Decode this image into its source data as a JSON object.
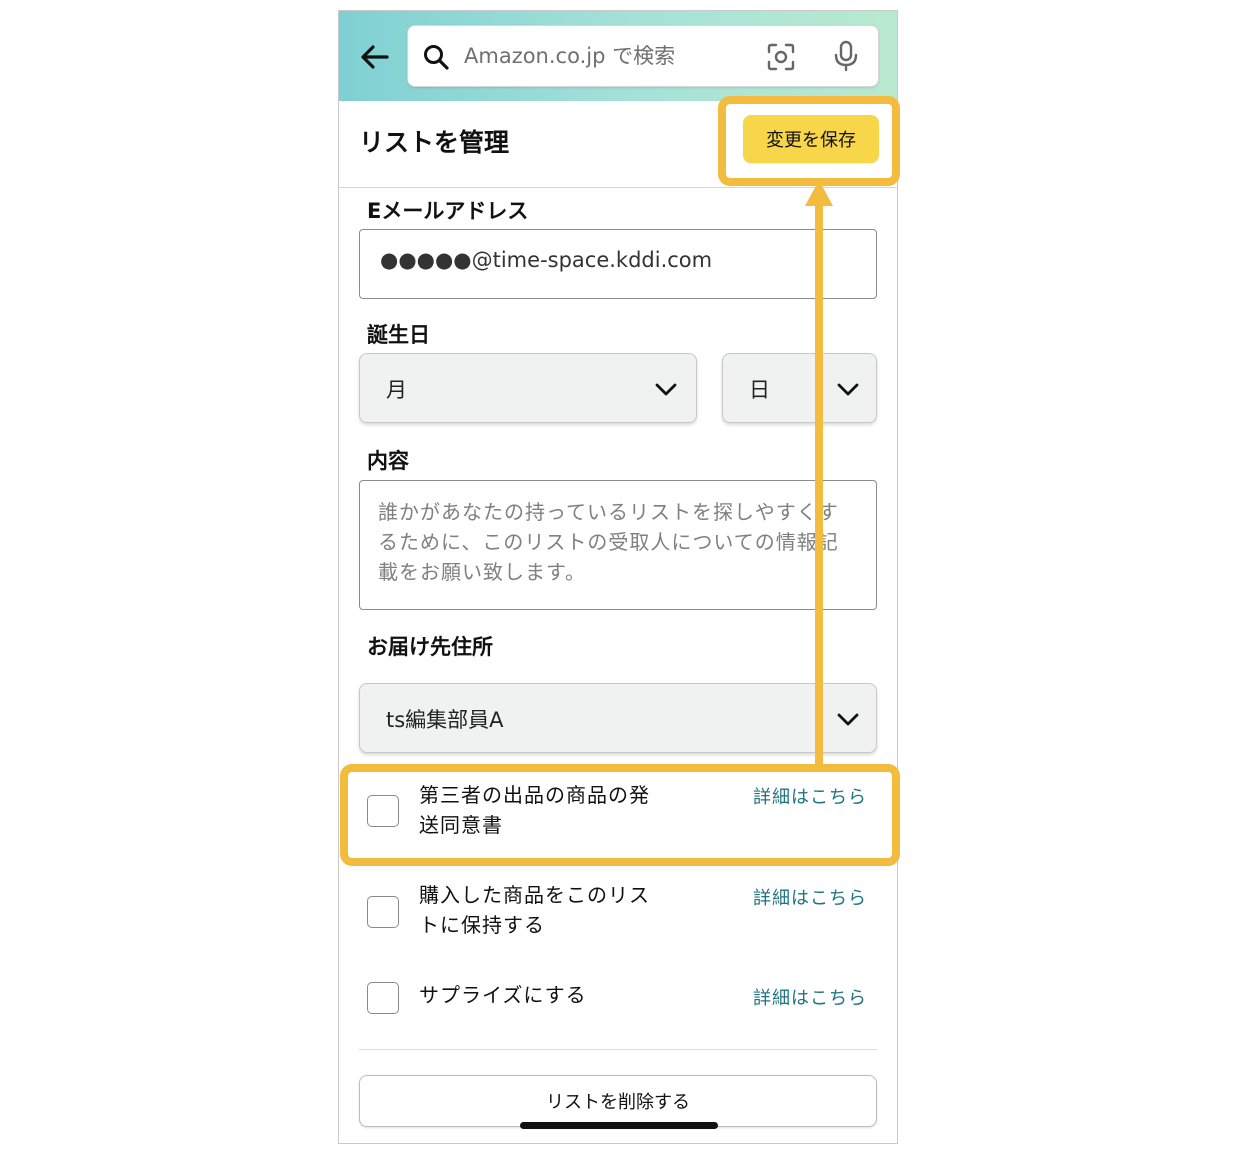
{
  "header": {
    "search_placeholder": "Amazon.co.jp で検索"
  },
  "page": {
    "title": "リストを管理",
    "save_label": "変更を保存"
  },
  "form": {
    "email_label": "Eメールアドレス",
    "email_value": "●●●●●@time-space.kddi.com",
    "birthday_label": "誕生日",
    "month_value": "月",
    "day_value": "日",
    "description_label": "内容",
    "description_placeholder": "誰かがあなたの持っているリストを探しやすくするために、このリストの受取人についての情報記載をお願い致します。",
    "address_label": "お届け先住所",
    "address_value": "ts編集部員A"
  },
  "options": [
    {
      "label": "第三者の出品の商品の発送同意書",
      "link": "詳細はこちら"
    },
    {
      "label": "購入した商品をこのリストに保持する",
      "link": "詳細はこちら"
    },
    {
      "label": "サプライズにする",
      "link": "詳細はこちら"
    }
  ],
  "footer": {
    "delete_label": "リストを削除する"
  },
  "colors": {
    "accent_yellow": "#f7d64a",
    "highlight": "#f3bc3e",
    "link": "#207481"
  },
  "icons": [
    "back-arrow-icon",
    "search-icon",
    "camera-icon",
    "mic-icon",
    "chevron-down-icon"
  ]
}
